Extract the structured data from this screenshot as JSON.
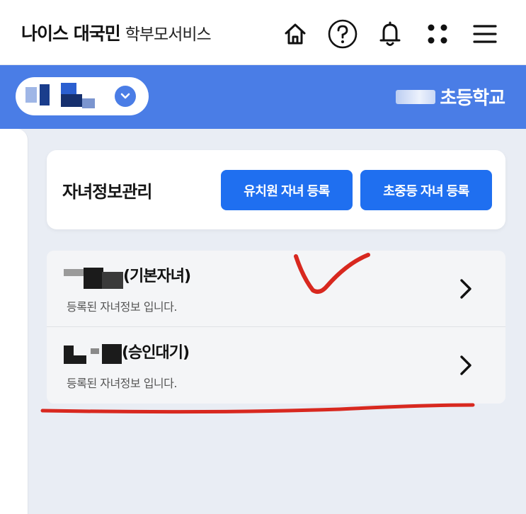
{
  "header": {
    "brand_main": "나이스 대국민",
    "brand_sub": "학부모서비스",
    "icons": [
      "home-icon",
      "help-icon",
      "bell-icon",
      "apps-icon",
      "menu-icon"
    ]
  },
  "school_bar": {
    "school_name": "초등학교"
  },
  "manage": {
    "title": "자녀정보관리",
    "kinder_button": "유치원 자녀 등록",
    "school_button": "초중등 자녀 등록"
  },
  "children": [
    {
      "name": "(기본자녀)",
      "subtitle": "등록된 자녀정보 입니다."
    },
    {
      "name": "(승인대기)",
      "subtitle": "등록된 자녀정보 입니다."
    }
  ],
  "colors": {
    "primary_blue": "#4a7de6",
    "button_blue": "#1f6ff0",
    "annotation_red": "#d8281f"
  }
}
